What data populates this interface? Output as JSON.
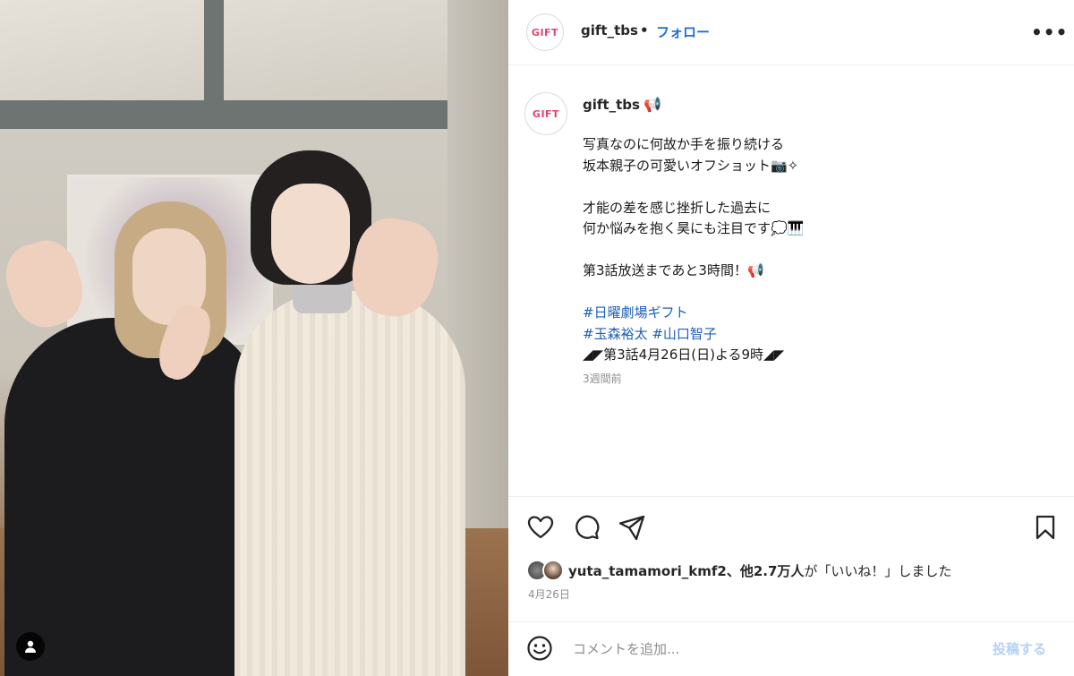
{
  "post": {
    "header": {
      "username": "gift_tbs",
      "dot": "•",
      "follow_label": "フォロー",
      "more_label": "•••",
      "avatar_text": "GIFT"
    },
    "caption": {
      "username": "gift_tbs",
      "megaphone": "📢",
      "lines": [
        "写真なのに何故か手を振り続ける",
        "坂本親子の可愛いオフショット📷✧",
        "",
        "才能の差を感じ挫折した過去に",
        "何か悩みを抱く昊にも注目です💭🎹",
        "",
        "第3話放送まであと3時間！📢"
      ],
      "hashtags": [
        "#日曜劇場ギフト",
        "#玉森裕太 #山口智子"
      ],
      "schedule": "◢◤第3話4月26日(日)よる9時◢◤",
      "time_ago": "3週間前"
    },
    "likes": {
      "first_user": "yuta_tamamori_kmf2",
      "others": "、他2.7万人",
      "suffix": "が「いいね！」しました"
    },
    "date": "4月26日",
    "comment": {
      "placeholder": "コメントを追加...",
      "post_label": "投稿する"
    },
    "colors": {
      "accent_link": "#1c6fd1",
      "hashtag": "#1c5fb8",
      "post_button_disabled": "#b3d1f6",
      "avatar_brand": "#e0456e"
    },
    "icons": {
      "like": "heart-icon",
      "comment": "comment-icon",
      "share": "paper-plane-icon",
      "save": "bookmark-icon",
      "emoji": "smiley-icon",
      "tags": "user-tag-icon"
    }
  }
}
